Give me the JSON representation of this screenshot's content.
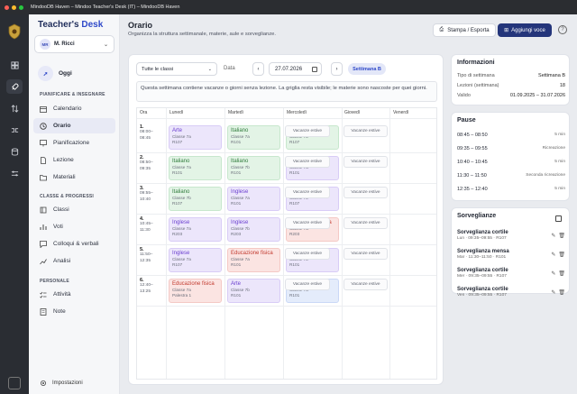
{
  "window": {
    "title": "MindooDB Haven – Mindoo Teacher's Desk (IT) – MindooDB Haven"
  },
  "brand": {
    "part1": "Teacher's ",
    "part2": "Desk"
  },
  "user": {
    "initials": "MR",
    "name": "M. Ricci"
  },
  "today": {
    "label": "Oggi"
  },
  "sections": {
    "plan": "PIANIFICARE & INSEGNARE",
    "classes": "CLASSE & PROGRESSI",
    "personal": "PERSONALE"
  },
  "nav": {
    "calendario": "Calendario",
    "orario": "Orario",
    "pianificazione": "Pianificazione",
    "lezione": "Lezione",
    "materiali": "Materiali",
    "classi": "Classi",
    "voti": "Voti",
    "colloqui": "Colloqui & verbali",
    "analisi": "Analisi",
    "attivita": "Attività",
    "note": "Note",
    "impostazioni": "Impostazioni"
  },
  "page": {
    "title": "Orario",
    "subtitle": "Organizza la struttura settimanale, materie, aule e sorveglianze."
  },
  "toolbar": {
    "print": "Stampa / Esporta",
    "add": "Aggiungi voce",
    "help": "?"
  },
  "filters": {
    "class_select": "Tutte le classi",
    "date_label": "Data",
    "date": "27.07.2026",
    "prev": "‹",
    "next": "›",
    "week_badge": "Settimana B"
  },
  "notice": "Questa settimana contiene vacanze o giorni senza lezione. La griglia resta visibile; le materie sono nascoste per quei giorni.",
  "schedule": {
    "headers": [
      "Ora",
      "Lunedì",
      "Martedì",
      "Mercoledì",
      "Giovedì",
      "Venerdì"
    ],
    "holiday_label": "Vacanze estive",
    "periods": [
      {
        "num": "1.",
        "start": "08:00–",
        "end": "08:45",
        "lessons": [
          {
            "subject": "Arte",
            "class": "Classe 7a",
            "room": "R107",
            "color": "violet"
          },
          {
            "subject": "Italiano",
            "class": "Classe 7a",
            "room": "R101",
            "color": "green"
          },
          {
            "subject": "Italiano",
            "class": "Classe 7b",
            "room": "R107",
            "color": "green"
          }
        ]
      },
      {
        "num": "2.",
        "start": "08:50–",
        "end": "09:35",
        "lessons": [
          {
            "subject": "Italiano",
            "class": "Classe 7a",
            "room": "R101",
            "color": "green"
          },
          {
            "subject": "Italiano",
            "class": "Classe 7b",
            "room": "R101",
            "color": "green"
          },
          {
            "subject": "Inglese",
            "class": "Classe 7a",
            "room": "R101",
            "color": "violet"
          }
        ]
      },
      {
        "num": "3.",
        "start": "09:55–",
        "end": "10:40",
        "lessons": [
          {
            "subject": "Italiano",
            "class": "Classe 7b",
            "room": "R107",
            "color": "green"
          },
          {
            "subject": "Inglese",
            "class": "Classe 7a",
            "room": "R101",
            "color": "violet"
          },
          {
            "subject": "Inglese",
            "class": "Classe 7b",
            "room": "R107",
            "color": "violet"
          }
        ]
      },
      {
        "num": "4.",
        "start": "10:45–",
        "end": "11:30",
        "lessons": [
          {
            "subject": "Inglese",
            "class": "Classe 7a",
            "room": "R203",
            "color": "violet"
          },
          {
            "subject": "Inglese",
            "class": "Classe 7b",
            "room": "R203",
            "color": "violet"
          },
          {
            "subject": "Educazione fisica",
            "class": "Classe 7a",
            "room": "R203",
            "color": "red"
          }
        ]
      },
      {
        "num": "5.",
        "start": "11:50–",
        "end": "12:35",
        "lessons": [
          {
            "subject": "Inglese",
            "class": "Classe 7a",
            "room": "R107",
            "color": "violet"
          },
          {
            "subject": "Educazione fisica",
            "class": "Classe 7a",
            "room": "R101",
            "color": "red"
          },
          {
            "subject": "Arte",
            "class": "Classe 7b",
            "room": "R101",
            "color": "violet"
          }
        ]
      },
      {
        "num": "6.",
        "start": "12:40–",
        "end": "13:25",
        "lessons": [
          {
            "subject": "Educazione fisica",
            "class": "Classe 7a",
            "room": "Palestra 1",
            "color": "red"
          },
          {
            "subject": "Arte",
            "class": "Classe 7b",
            "room": "R101",
            "color": "violet"
          },
          {
            "subject": "Matematica",
            "class": "Classe 7a",
            "room": "R101",
            "color": "blue"
          }
        ]
      }
    ]
  },
  "info": {
    "title": "Informazioni",
    "rows": [
      {
        "k": "Tipo di settimana",
        "v": "Settimana B"
      },
      {
        "k": "Lezioni (settimana)",
        "v": "18"
      },
      {
        "k": "Valido",
        "v": "01.09.2025 – 31.07.2026"
      }
    ]
  },
  "pause": {
    "title": "Pause",
    "rows": [
      {
        "t": "08:45 – 08:50",
        "m": "5 min"
      },
      {
        "t": "09:35 – 09:55",
        "m": "Ricreazione"
      },
      {
        "t": "10:40 – 10:45",
        "m": "5 min"
      },
      {
        "t": "11:30 – 11:50",
        "m": "Seconda ricreazione"
      },
      {
        "t": "12:35 – 12:40",
        "m": "5 min"
      }
    ]
  },
  "sorveglianze": {
    "title": "Sorveglianze",
    "items": [
      {
        "t": "Sorveglianza cortile",
        "d": "Lun · 09:35–09:55 · R107"
      },
      {
        "t": "Sorveglianza mensa",
        "d": "Mar · 11:30–11:50 · R101"
      },
      {
        "t": "Sorveglianza cortile",
        "d": "Mer · 09:35–09:55 · R107"
      },
      {
        "t": "Sorveglianza cortile",
        "d": "Ven · 09:35–09:55 · R107"
      }
    ]
  },
  "colors": {
    "accent": "#24357a",
    "brand": "#2f49c9",
    "rail": "#2a2d33"
  }
}
